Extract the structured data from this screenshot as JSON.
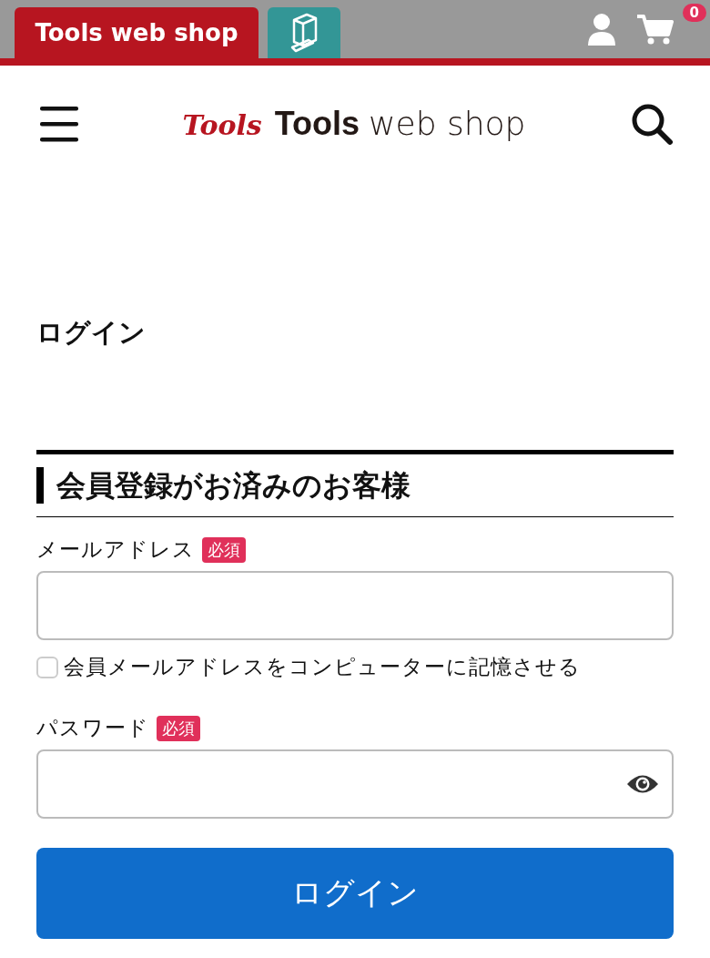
{
  "top_bar": {
    "site_tab": {
      "label": "Tools web shop",
      "selected": true
    },
    "cart_count": "0"
  },
  "header": {
    "logo": {
      "script": "Tools",
      "bold": "Tools",
      "light": "web shop"
    }
  },
  "page_title": "ログイン",
  "section": {
    "title": "会員登録がお済みのお客様",
    "email": {
      "label": "メールアドレス",
      "badge": "必須"
    },
    "remember": {
      "label": "会員メールアドレスをコンピューターに記憶させる",
      "checked": false
    },
    "password": {
      "label": "パスワード",
      "badge": "必須"
    },
    "submit": "ログイン"
  }
}
